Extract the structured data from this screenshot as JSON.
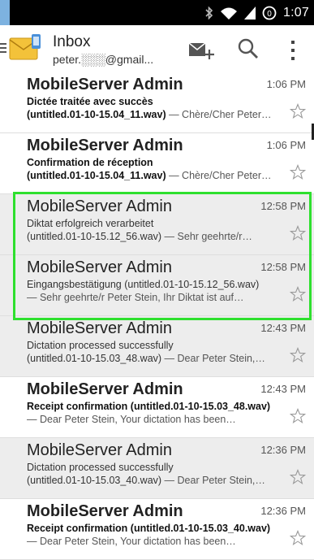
{
  "status_bar": {
    "time": "1:07",
    "alarm_label": "0"
  },
  "action_bar": {
    "title": "Inbox",
    "account": "peter.░░░@gmail...",
    "icons": [
      "drawer-menu-icon",
      "gmail-envelope-icon",
      "compose-icon",
      "search-icon",
      "overflow-menu-icon"
    ]
  },
  "messages": [
    {
      "sender": "MobileServer Admin",
      "time": "1:06 PM",
      "unread": true,
      "subject": "Dictée traitée avec succès",
      "line2_subject": "(untitled.01-10-15.04_11.wav)",
      "line2_snippet": " — Chère/Cher Peter…"
    },
    {
      "sender": "MobileServer Admin",
      "time": "1:06 PM",
      "unread": true,
      "subject": "Confirmation de réception",
      "line2_subject": "(untitled.01-10-15.04_11.wav)",
      "line2_snippet": " — Chère/Cher Peter…"
    },
    {
      "sender": "MobileServer Admin",
      "time": "12:58 PM",
      "unread": false,
      "subject": "Diktat erfolgreich verarbeitet",
      "line2_subject": "(untitled.01-10-15.12_56.wav)",
      "line2_snippet": " — Sehr geehrte/r…"
    },
    {
      "sender": "MobileServer Admin",
      "time": "12:58 PM",
      "unread": false,
      "subject": "Eingangsbestätigung (untitled.01-10-15.12_56.wav)",
      "line2_subject": "",
      "line2_snippet": "— Sehr geehrte/r Peter Stein, Ihr Diktat ist auf…"
    },
    {
      "sender": "MobileServer Admin",
      "time": "12:43 PM",
      "unread": false,
      "subject": "Dictation processed successfully",
      "line2_subject": "(untitled.01-10-15.03_48.wav)",
      "line2_snippet": " — Dear Peter Stein,…"
    },
    {
      "sender": "MobileServer Admin",
      "time": "12:43 PM",
      "unread": true,
      "subject": "Receipt confirmation (untitled.01-10-15.03_48.wav)",
      "line2_subject": "",
      "line2_snippet": "— Dear Peter Stein, Your dictation has been…"
    },
    {
      "sender": "MobileServer Admin",
      "time": "12:36 PM",
      "unread": false,
      "subject": "Dictation processed successfully",
      "line2_subject": "(untitled.01-10-15.03_40.wav)",
      "line2_snippet": " — Dear Peter Stein,…"
    },
    {
      "sender": "MobileServer Admin",
      "time": "12:36 PM",
      "unread": true,
      "subject": "Receipt confirmation (untitled.01-10-15.03_40.wav)",
      "line2_subject": "",
      "line2_snippet": "— Dear Peter Stein, Your dictation has been…"
    }
  ],
  "colors": {
    "selection_highlight": "#2ee02e",
    "read_background": "#ededed",
    "status_bar": "#000000"
  }
}
